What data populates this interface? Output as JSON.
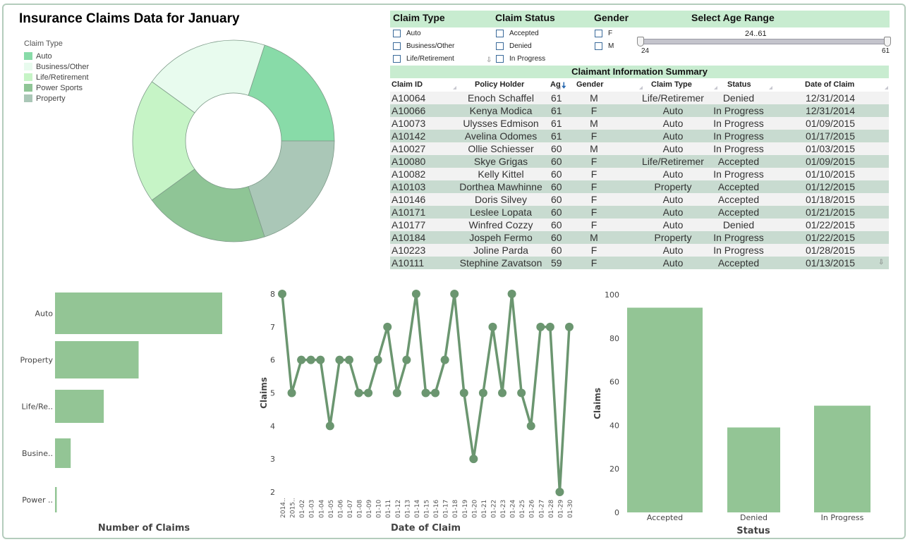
{
  "title": "Insurance Claims Data for January",
  "colors": {
    "accent": "#c8ecd0",
    "bar": "#93c595",
    "line": "#6b9670",
    "row_alt": "#c8dbd0"
  },
  "legend": {
    "title": "Claim Type",
    "items": [
      {
        "label": "Auto",
        "color": "#88dba8"
      },
      {
        "label": "Business/Other",
        "color": "#e8fbee"
      },
      {
        "label": "Life/Retirement",
        "color": "#c6f4c6"
      },
      {
        "label": "Power Sports",
        "color": "#8fc596"
      },
      {
        "label": "Property",
        "color": "#aac7b7"
      }
    ]
  },
  "filters": {
    "claim_type": {
      "header": "Claim Type",
      "options": [
        "Auto",
        "Business/Other",
        "Life/Retirement"
      ]
    },
    "claim_status": {
      "header": "Claim Status",
      "options": [
        "Accepted",
        "Denied",
        "In Progress"
      ]
    },
    "gender": {
      "header": "Gender",
      "options": [
        "F",
        "M"
      ]
    },
    "age_range": {
      "header": "Select Age Range",
      "label": "24..61",
      "min": "24",
      "max": "61",
      "selected_low": 24,
      "selected_high": 61
    }
  },
  "table": {
    "title": "Claimant Information Summary",
    "columns": [
      "Claim ID",
      "Policy Holder",
      "Ag",
      "Gender",
      "Claim Type",
      "Status",
      "Date of Claim"
    ],
    "rows": [
      [
        "A10064",
        "Enoch Schaffel",
        "61",
        "M",
        "Life/Retiremer",
        "Denied",
        "12/31/2014"
      ],
      [
        "A10066",
        "Kenya Modica",
        "61",
        "F",
        "Auto",
        "In Progress",
        "12/31/2014"
      ],
      [
        "A10073",
        "Ulysses Edmison",
        "61",
        "M",
        "Auto",
        "In Progress",
        "01/09/2015"
      ],
      [
        "A10142",
        "Avelina Odomes",
        "61",
        "F",
        "Auto",
        "In Progress",
        "01/17/2015"
      ],
      [
        "A10027",
        "Ollie Schiesser",
        "60",
        "M",
        "Auto",
        "In Progress",
        "01/03/2015"
      ],
      [
        "A10080",
        "Skye Grigas",
        "60",
        "F",
        "Life/Retiremer",
        "Accepted",
        "01/09/2015"
      ],
      [
        "A10082",
        "Kelly Kittel",
        "60",
        "F",
        "Auto",
        "In Progress",
        "01/10/2015"
      ],
      [
        "A10103",
        "Dorthea Mawhinne",
        "60",
        "F",
        "Property",
        "Accepted",
        "01/12/2015"
      ],
      [
        "A10146",
        "Doris Silvey",
        "60",
        "F",
        "Auto",
        "Accepted",
        "01/18/2015"
      ],
      [
        "A10171",
        "Leslee Lopata",
        "60",
        "F",
        "Auto",
        "Accepted",
        "01/21/2015"
      ],
      [
        "A10177",
        "Winfred Cozzy",
        "60",
        "F",
        "Auto",
        "Denied",
        "01/22/2015"
      ],
      [
        "A10184",
        "Jospeh Fermo",
        "60",
        "M",
        "Property",
        "In Progress",
        "01/22/2015"
      ],
      [
        "A10223",
        "Joline Parda",
        "60",
        "F",
        "Auto",
        "In Progress",
        "01/28/2015"
      ],
      [
        "A10111",
        "Stephine Zavatson",
        "59",
        "F",
        "Auto",
        "Accepted",
        "01/13/2015"
      ]
    ]
  },
  "chart_data": [
    {
      "type": "pie",
      "title": "",
      "legend_title": "Claim Type",
      "legend_position": "top-left",
      "donut": true,
      "categories": [
        "Auto",
        "Business/Other",
        "Life/Retirement",
        "Power Sports",
        "Property"
      ],
      "values": [
        1,
        1,
        1,
        1,
        1
      ]
    },
    {
      "type": "bar",
      "orientation": "horizontal",
      "categories": [
        "Auto",
        "Property",
        "Life/Re..",
        "Busine..",
        "Power .."
      ],
      "values": [
        96,
        48,
        28,
        9,
        1
      ],
      "xlabel": "Number of Claims",
      "ylabel": "",
      "grid": false
    },
    {
      "type": "line",
      "x": [
        "2014..",
        "2015..",
        "01-02",
        "01-03",
        "01-04",
        "01-05",
        "01-06",
        "01-07",
        "01-08",
        "01-09",
        "01-10",
        "01-11",
        "01-12",
        "01-13",
        "01-14",
        "01-15",
        "01-16",
        "01-17",
        "01-18",
        "01-19",
        "01-20",
        "01-21",
        "01-22",
        "01-23",
        "01-24",
        "01-25",
        "01-26",
        "01-27",
        "01-28",
        "01-29",
        "01-30"
      ],
      "values": [
        8,
        5,
        6,
        6,
        6,
        4,
        6,
        6,
        5,
        5,
        6,
        7,
        5,
        6,
        8,
        5,
        5,
        6,
        8,
        5,
        3,
        5,
        7,
        5,
        8,
        5,
        4,
        7,
        7,
        2,
        7
      ],
      "xlabel": "Date of Claim",
      "ylabel": "Claims",
      "ylim": [
        2,
        8
      ],
      "yticks": [
        "2",
        "3",
        "4",
        "5",
        "6",
        "7",
        "8"
      ],
      "grid": false
    },
    {
      "type": "bar",
      "categories": [
        "Accepted",
        "Denied",
        "In Progress"
      ],
      "values": [
        94,
        39,
        49
      ],
      "xlabel": "Status",
      "ylabel": "Claims",
      "ylim": [
        0,
        100
      ],
      "yticks": [
        "0",
        "20",
        "40",
        "60",
        "80",
        "100"
      ],
      "grid": false
    }
  ]
}
